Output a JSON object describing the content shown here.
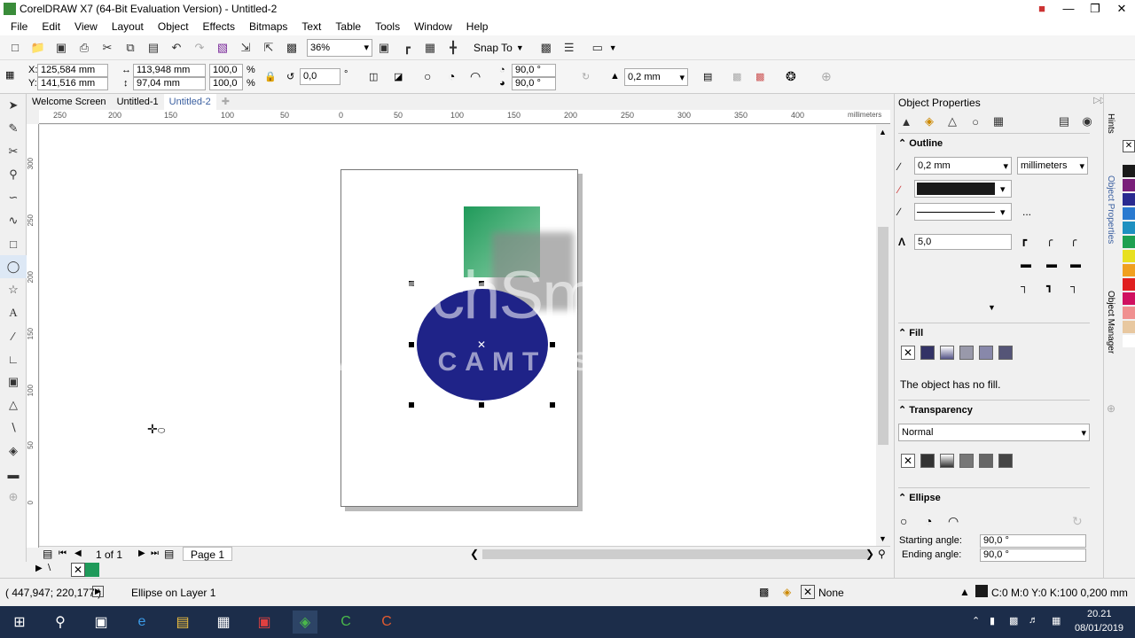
{
  "app": {
    "title": "CorelDRAW X7 (64-Bit Evaluation Version) - Untitled-2"
  },
  "menu": [
    "File",
    "Edit",
    "View",
    "Layout",
    "Object",
    "Effects",
    "Bitmaps",
    "Text",
    "Table",
    "Tools",
    "Window",
    "Help"
  ],
  "toolbar": {
    "zoom": "36%",
    "snap_to": "Snap To"
  },
  "propbar": {
    "x": "125,584 mm",
    "y": "141,516 mm",
    "w": "113,948 mm",
    "h": "97,04 mm",
    "sx": "100,0",
    "sy": "100,0",
    "pct": "%",
    "rotation": "0,0",
    "deg": "°",
    "start_angle": "90,0 °",
    "end_angle": "90,0 °",
    "outline_width": "0,2 mm"
  },
  "tabs": [
    "Welcome Screen",
    "Untitled-1",
    "Untitled-2"
  ],
  "ruler": {
    "h_ticks": [
      "250",
      "200",
      "150",
      "100",
      "50",
      "0",
      "50",
      "100",
      "150",
      "200",
      "250",
      "300",
      "350",
      "400"
    ],
    "unit": "millimeters",
    "v_ticks": [
      "300",
      "250",
      "200",
      "150",
      "100",
      "50",
      "0"
    ]
  },
  "watermark": {
    "line1": "TechSmith",
    "line2": "MADE WITH CAMTASIA FREE TRIAL"
  },
  "pagenav": {
    "count": "1 of 1",
    "page": "Page 1"
  },
  "status": {
    "coords": "( 447,947; 220,177 )",
    "selection": "Ellipse on Layer 1",
    "fill": "None",
    "outline": "C:0 M:0 Y:0 K:100  0,200 mm"
  },
  "panel": {
    "title": "Object Properties",
    "outline": {
      "heading": "Outline",
      "width": "0,2 mm",
      "units": "millimeters",
      "miter": "5,0",
      "more": "..."
    },
    "fill": {
      "heading": "Fill",
      "text": "The object has no fill."
    },
    "transparency": {
      "heading": "Transparency",
      "mode": "Normal"
    },
    "ellipse": {
      "heading": "Ellipse",
      "start_label": "Starting angle:",
      "start": "90,0 °",
      "end_label": "Ending angle:",
      "end": "90,0 °"
    }
  },
  "sidetabs": [
    "Hints",
    "Object Properties",
    "Object Manager"
  ],
  "clock": {
    "time": "20.21",
    "date": "08/01/2019"
  },
  "colors": {
    "ellipse": "#1f2388",
    "green": "#1f9a5a",
    "swatches": [
      "#1a1a1a",
      "#7a1f7a",
      "#2a2a90",
      "#2a7ad0",
      "#1e90c0",
      "#1ea050",
      "#e8e020",
      "#f0a020",
      "#e02020",
      "#d01060",
      "#f09090",
      "#e8c8a0",
      "#ffffff"
    ]
  }
}
